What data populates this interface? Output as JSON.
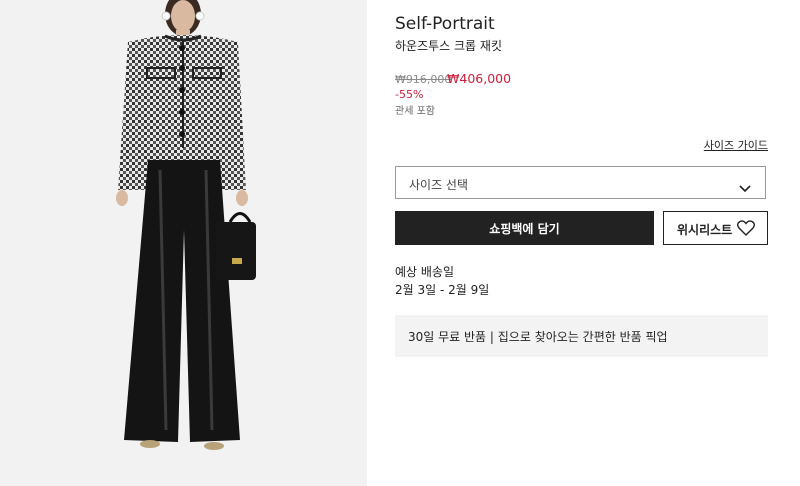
{
  "product": {
    "brand": "Self-Portrait",
    "name": "하운즈투스 크롭 재킷",
    "original_price": "₩916,000",
    "sale_price": "₩406,000",
    "discount": "-55%",
    "duty_note": "관세 포함"
  },
  "size": {
    "guide_link": "사이즈 가이드",
    "select_placeholder": "사이즈 선택"
  },
  "actions": {
    "add_to_bag": "쇼핑백에 담기",
    "wishlist": "위시리스트"
  },
  "delivery": {
    "title": "예상 배송일",
    "dates": "2월 3일 - 2월 9일"
  },
  "returns": {
    "text": "30일 무료 반품 | 집으로 찾아오는 간편한 반품 픽업"
  },
  "colors": {
    "sale": "#cf1f3b",
    "primary_button": "#222222",
    "image_background": "#f2f2f2"
  },
  "icons": {
    "select_chevron": "chevron-down-icon",
    "wishlist": "heart-icon"
  }
}
